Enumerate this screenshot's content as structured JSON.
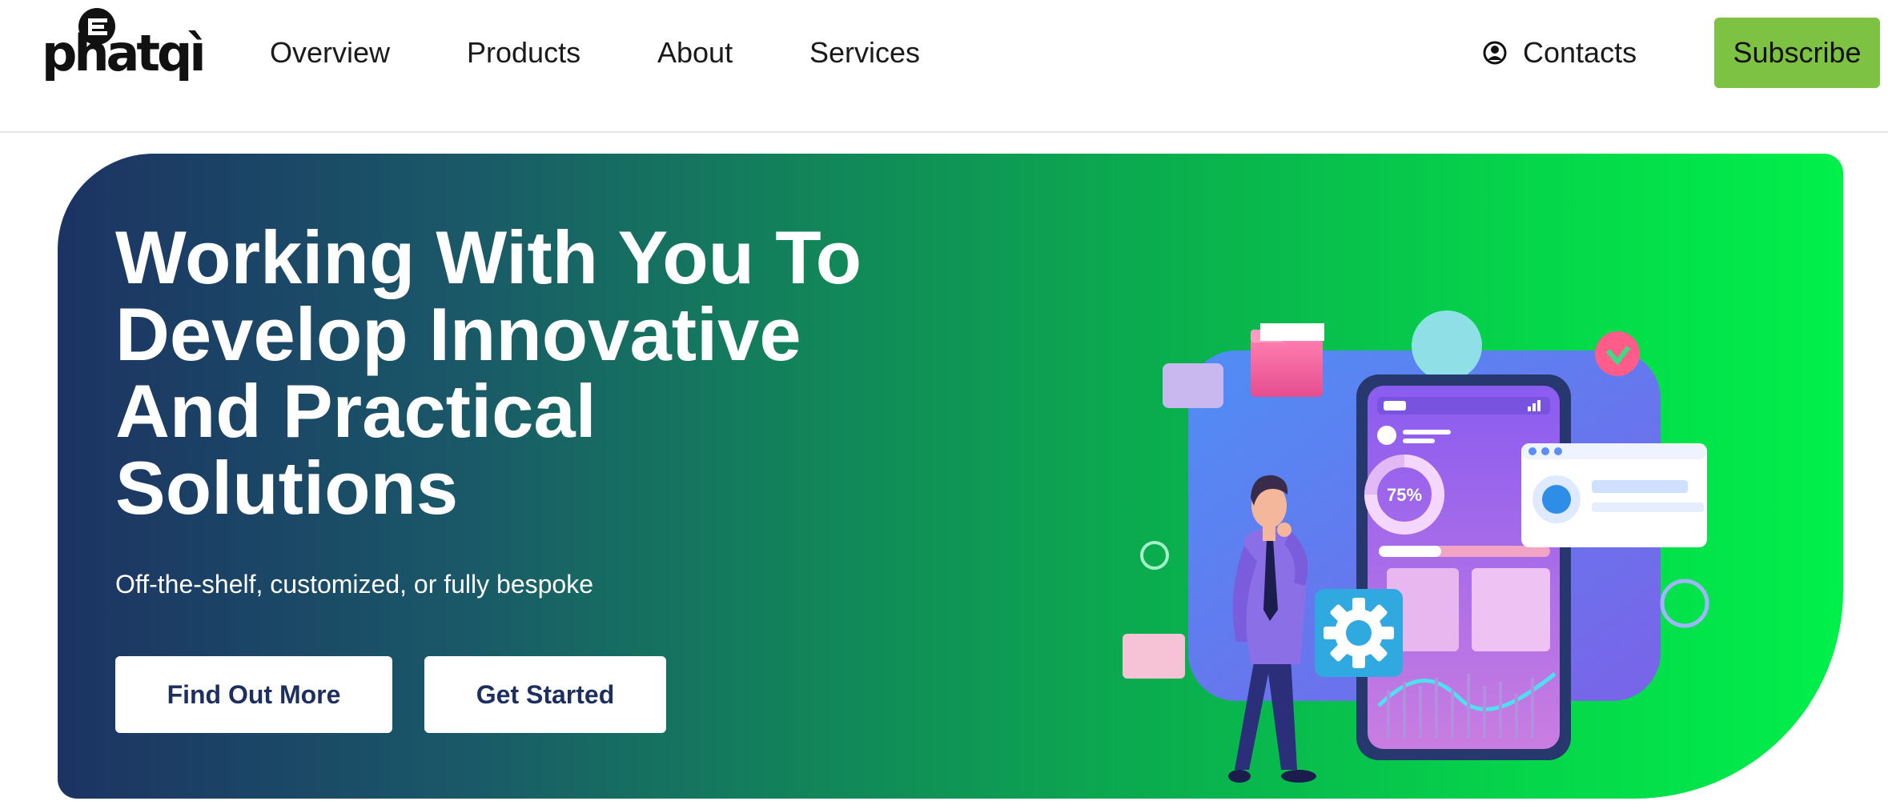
{
  "brand": {
    "logo_text": "phatqì"
  },
  "nav": {
    "items": [
      {
        "label": "Overview"
      },
      {
        "label": "Products"
      },
      {
        "label": "About"
      },
      {
        "label": "Services"
      }
    ],
    "contacts_label": "Contacts",
    "contacts_icon": "user-circle-icon",
    "subscribe_label": "Subscribe"
  },
  "hero": {
    "title_lines": [
      "Working With You To",
      "Develop Innovative",
      "And Practical",
      "Solutions"
    ],
    "subtitle": "Off-the-shelf, customized, or fully bespoke",
    "primary_button": "Find Out More",
    "secondary_button": "Get Started"
  },
  "illustration": {
    "progress_label": "75%"
  },
  "colors": {
    "subscribe_bg": "#7dc242",
    "hero_gradient_start": "#1c3363",
    "hero_gradient_end": "#00f04a",
    "button_text": "#1c2f5e"
  }
}
